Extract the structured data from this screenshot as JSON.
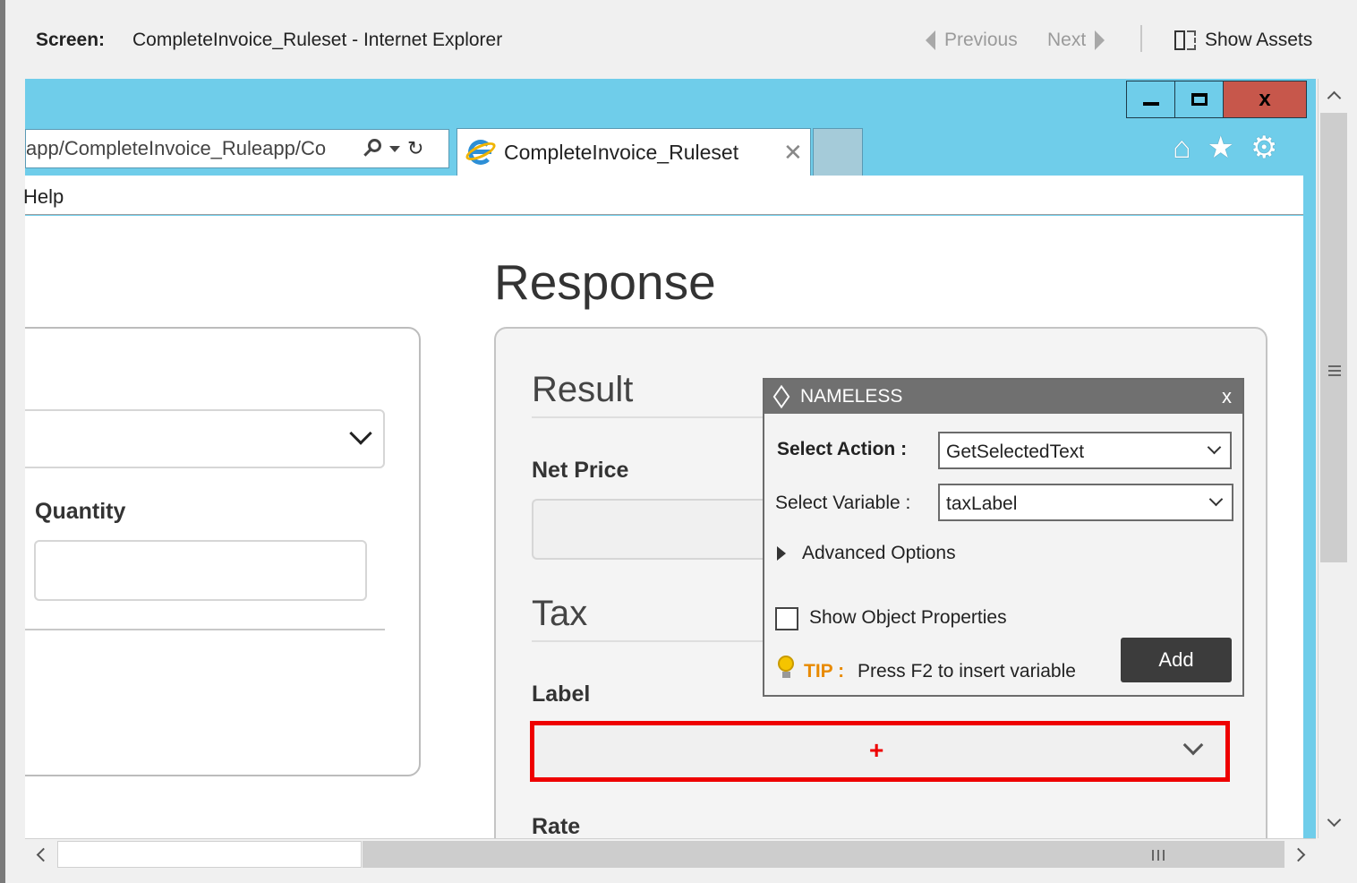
{
  "top_bar": {
    "screen_label": "Screen:",
    "screen_title": "CompleteInvoice_Ruleset - Internet Explorer",
    "previous_label": "Previous",
    "next_label": "Next",
    "show_assets_label": "Show Assets"
  },
  "browser": {
    "window_close_glyph": "x",
    "address_text": "app/CompleteInvoice_Ruleapp/Co",
    "tab_title": "CompleteInvoice_Ruleset",
    "tab_close_glyph": "✕",
    "menu_help": "Help",
    "icons": [
      "home-icon",
      "star-icon",
      "gear-icon",
      "search-icon",
      "refresh-icon"
    ]
  },
  "page": {
    "quantity_label": "Quantity",
    "response_title": "Response",
    "result_heading": "Result",
    "net_price_label": "Net Price",
    "tax_heading": "Tax",
    "label_label": "Label",
    "label_select_marker": "+",
    "rate_label": "Rate"
  },
  "popup": {
    "title": "NAMELESS",
    "close_glyph": "x",
    "select_action_label": "Select Action :",
    "select_action_value": "GetSelectedText",
    "select_variable_label": "Select Variable :",
    "select_variable_value": "taxLabel",
    "advanced_options_label": "Advanced Options",
    "show_object_properties_label": "Show Object Properties",
    "show_object_properties_checked": false,
    "tip_label": "TIP :",
    "tip_text": "Press F2 to insert variable",
    "add_button_label": "Add"
  },
  "colors": {
    "ie_chrome": "#6fcdea",
    "close_button": "#c7574b",
    "highlight_border": "#ee0000",
    "tip_accent": "#e88a00",
    "popup_header": "#707070",
    "add_button": "#3c3c3c"
  }
}
